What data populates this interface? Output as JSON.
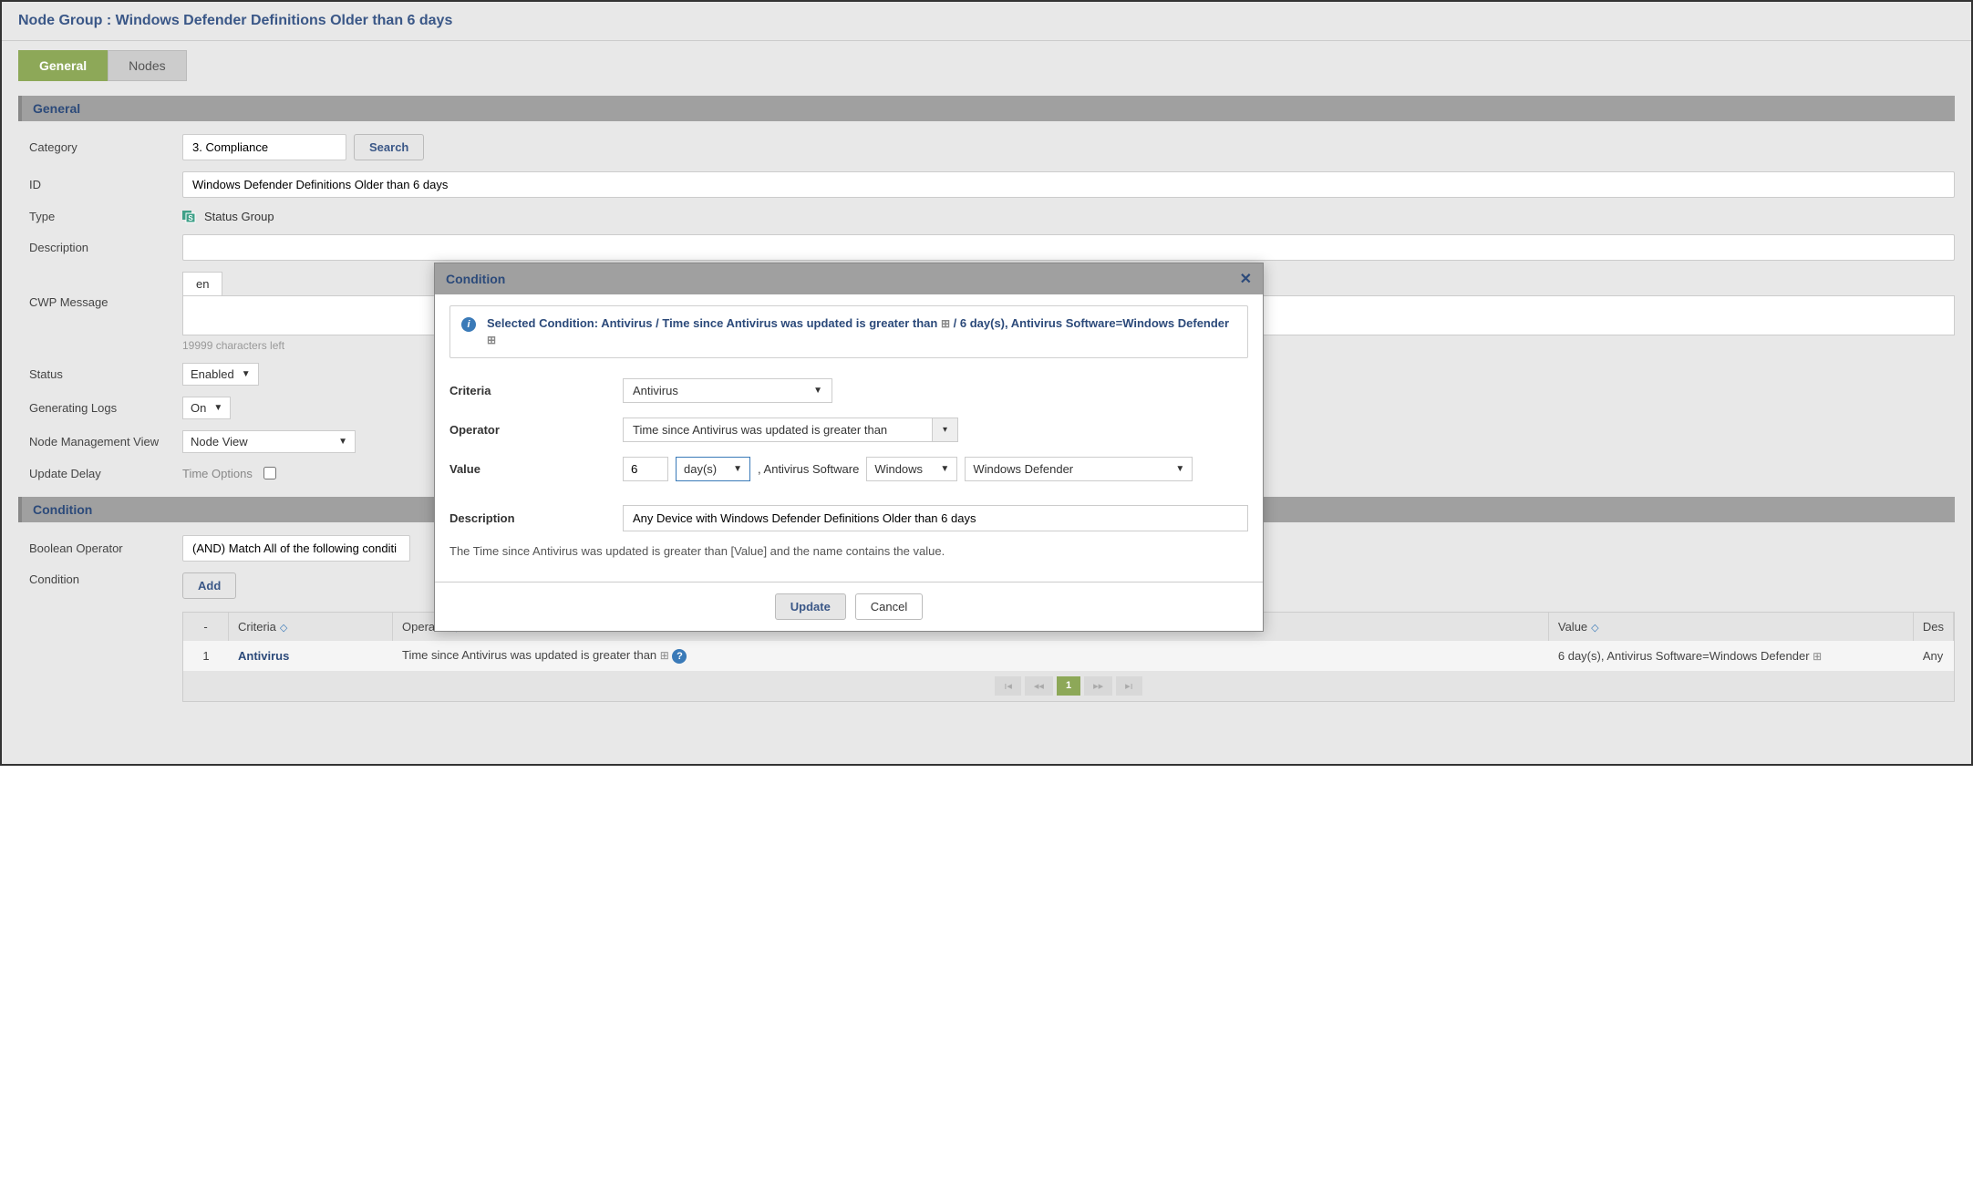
{
  "page_title": "Node Group : Windows Defender Definitions Older than 6 days",
  "tabs": {
    "general": "General",
    "nodes": "Nodes"
  },
  "sections": {
    "general": "General",
    "condition": "Condition"
  },
  "general": {
    "category_label": "Category",
    "category_value": "3. Compliance",
    "search_btn": "Search",
    "id_label": "ID",
    "id_value": "Windows Defender Definitions Older than 6 days",
    "type_label": "Type",
    "type_value": "Status Group",
    "description_label": "Description",
    "description_value": "",
    "cwp_label": "CWP Message",
    "cwp_lang": "en",
    "chars_left": "19999 characters left",
    "status_label": "Status",
    "status_value": "Enabled",
    "genlogs_label": "Generating Logs",
    "genlogs_value": "On",
    "nodeview_label": "Node Management View",
    "nodeview_value": "Node View",
    "delay_label": "Update Delay",
    "delay_value": "Time Options"
  },
  "condition": {
    "bool_label": "Boolean Operator",
    "bool_value": "(AND) Match All of the following conditi",
    "cond_label": "Condition",
    "add_btn": "Add",
    "table": {
      "headers": {
        "idx": "-",
        "criteria": "Criteria",
        "operator": "Operator",
        "value": "Value",
        "desc": "Des"
      },
      "rows": [
        {
          "idx": "1",
          "criteria": "Antivirus",
          "operator": "Time since Antivirus was updated is greater than",
          "value": "6 day(s), Antivirus Software=Windows Defender",
          "desc": "Any"
        }
      ]
    },
    "pager_current": "1"
  },
  "modal": {
    "title": "Condition",
    "info_prefix": "Selected Condition: Antivirus / Time since Antivirus was updated is greater than",
    "info_mid": " / 6 day(s), Antivirus Software=Windows Defender",
    "criteria_label": "Criteria",
    "criteria_value": "Antivirus",
    "operator_label": "Operator",
    "operator_value": "Time since Antivirus was updated is greater than",
    "value_label": "Value",
    "value_num": "6",
    "value_unit": "day(s)",
    "value_software_label": ", Antivirus Software",
    "value_os": "Windows",
    "value_sw": "Windows Defender",
    "description_label": "Description",
    "description_value": "Any Device with Windows Defender Definitions Older than 6 days",
    "hint": "The Time since Antivirus was updated is greater than [Value] and the name contains the value.",
    "update_btn": "Update",
    "cancel_btn": "Cancel"
  }
}
